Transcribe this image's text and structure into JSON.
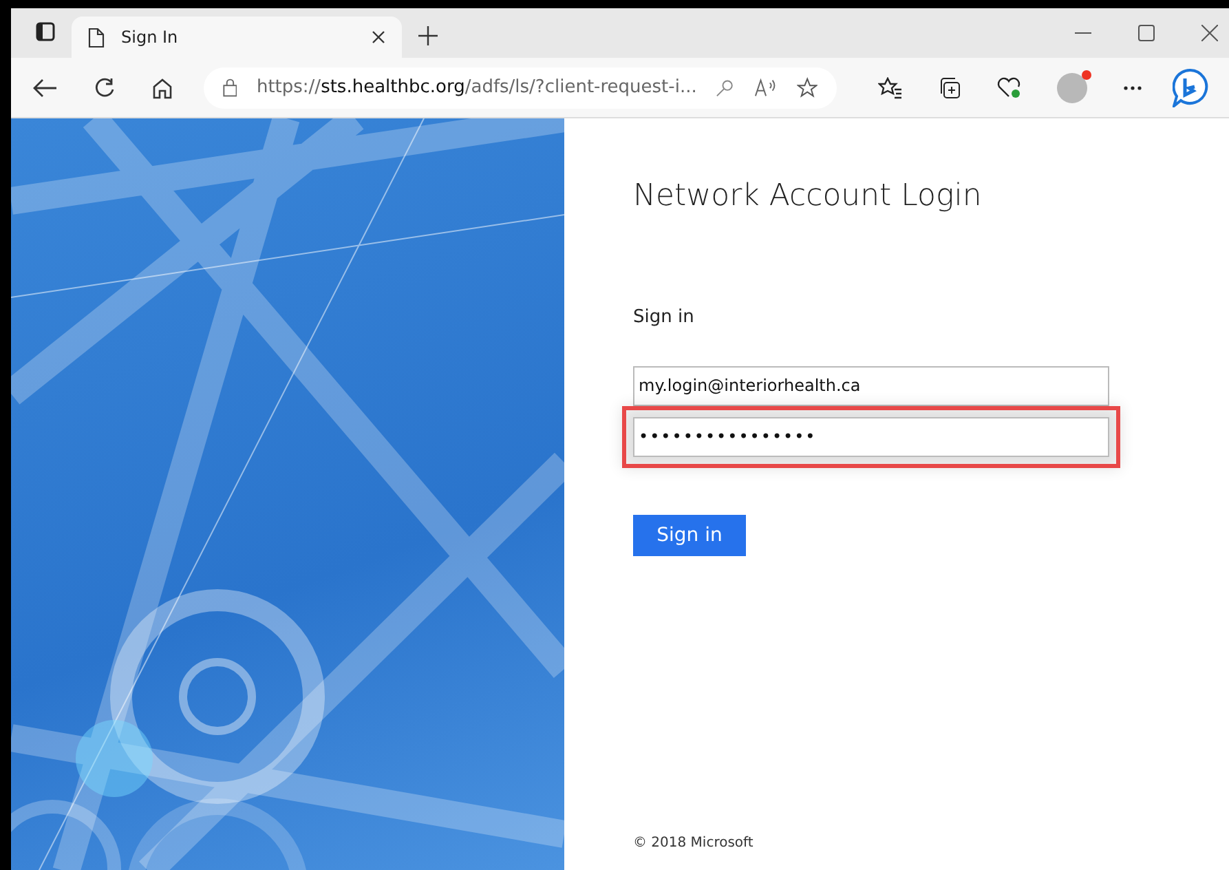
{
  "browser": {
    "tab": {
      "title": "Sign In"
    },
    "address": "https://**sts.healthbc.org**/adfs/ls/?client-request-i...",
    "profile_notification": true
  },
  "page": {
    "heading": "Network Account Login",
    "subheading": "Sign in",
    "fields": [
      {
        "kind": "text",
        "value": "my.login@interiorhealth.ca",
        "highlighted": false
      },
      {
        "kind": "password",
        "value": "••••••••••••••••",
        "highlighted": true
      }
    ],
    "button": "Sign in",
    "footer": "© 2018 Microsoft"
  }
}
